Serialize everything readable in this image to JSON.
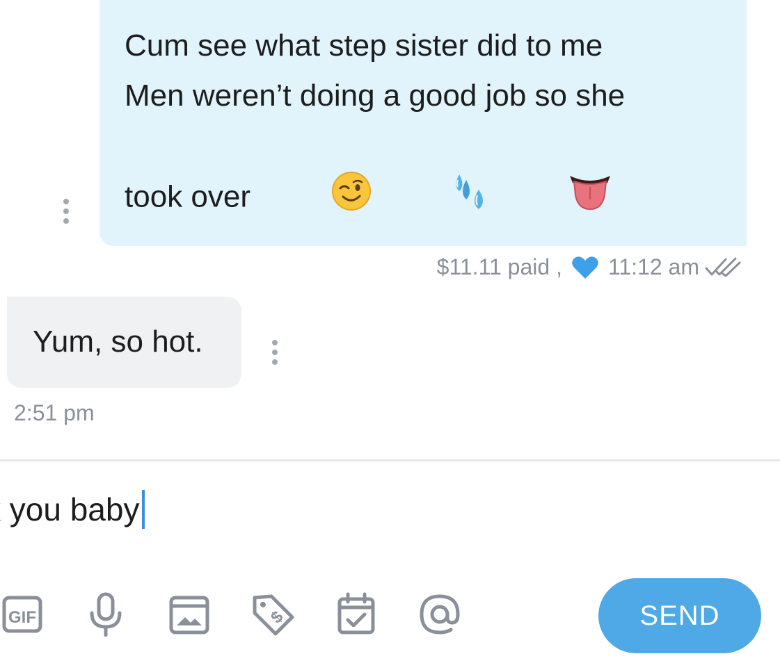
{
  "outgoing_message": {
    "lines": [
      "Cum see what step sister did to me",
      "",
      "Men weren’t doing a good job so she",
      "took over"
    ],
    "emojis": [
      "winking-face",
      "sweat-droplets",
      "tongue"
    ],
    "price_text": "$11.11 paid ,",
    "time": "11:12 am",
    "liked": true,
    "read_status": "double-check"
  },
  "incoming_message": {
    "text": "Yum, so hot.",
    "time": "2:51 pm"
  },
  "composer": {
    "value": "k you baby"
  },
  "toolbar": {
    "icons": [
      "gif-icon",
      "microphone-icon",
      "image-icon",
      "price-tag-icon",
      "schedule-icon",
      "mention-icon"
    ],
    "send_label": "SEND"
  },
  "colors": {
    "outgoing_bubble": "#e1f3fb",
    "incoming_bubble": "#f0f1f3",
    "accent": "#4ea9e6",
    "icon_gray": "#8a9099"
  }
}
